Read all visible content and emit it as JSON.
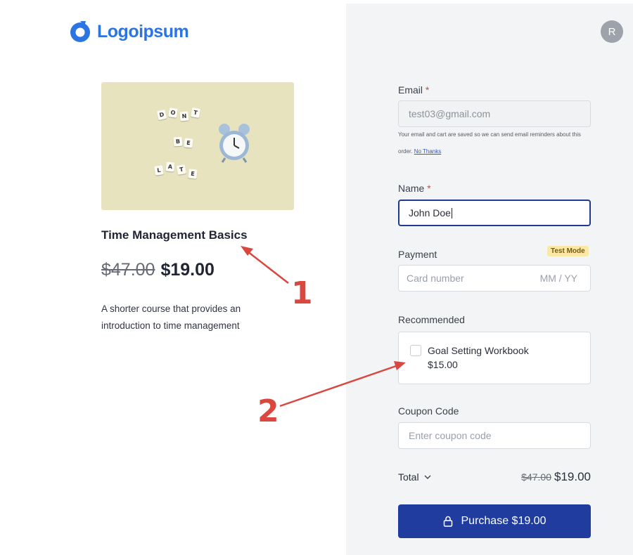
{
  "brand": {
    "name": "Logoipsum",
    "accent": "#2b74e2"
  },
  "user": {
    "avatar_initial": "R"
  },
  "product": {
    "image_tiles": [
      "D",
      "O",
      "N",
      "T",
      "B",
      "E",
      "L",
      "A",
      "T",
      "E"
    ],
    "title": "Time Management Basics",
    "old_price": "$47.00",
    "price": "$19.00",
    "description": "A shorter course that provides an introduction to time management"
  },
  "annotations": {
    "one": "1",
    "two": "2",
    "color": "#d9473e"
  },
  "form": {
    "email": {
      "label": "Email",
      "required_mark": "*",
      "value": "test03@gmail.com",
      "hint": "Your email and cart are saved so we can send email reminders about this order.",
      "hint_link": "No Thanks"
    },
    "name": {
      "label": "Name",
      "required_mark": "*",
      "value": "John Doe"
    },
    "payment": {
      "label": "Payment",
      "badge": "Test Mode",
      "card_placeholder": "Card number",
      "expiry_placeholder": "MM / YY"
    },
    "recommended": {
      "label": "Recommended",
      "item_name": "Goal Setting Workbook",
      "item_price": "$15.00",
      "checked": false
    },
    "coupon": {
      "label": "Coupon Code",
      "placeholder": "Enter coupon code"
    },
    "total": {
      "label": "Total",
      "old": "$47.00",
      "new": "$19.00"
    },
    "purchase_label": "Purchase $19.00"
  },
  "colors": {
    "primary_button": "#1f3c9e",
    "badge_bg": "#fbe8a6",
    "panel_bg": "#f3f4f6"
  }
}
